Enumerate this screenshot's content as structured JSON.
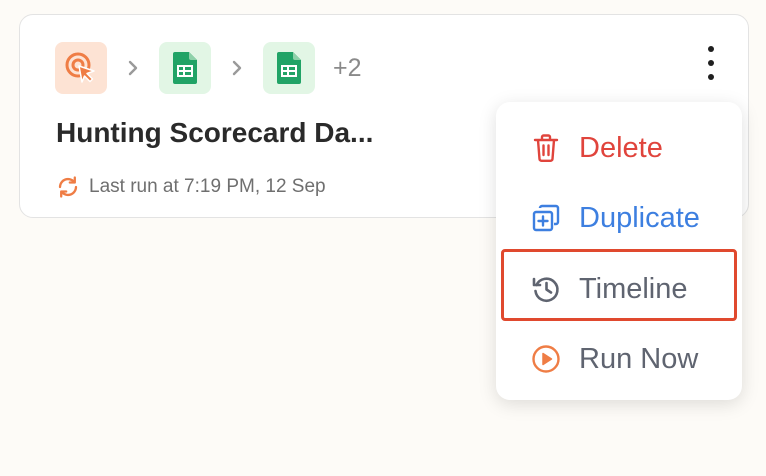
{
  "card": {
    "extra_steps": "+2",
    "title": "Hunting Scorecard Da...",
    "last_run": "Last run at 7:19 PM, 12 Sep",
    "steps": [
      {
        "app": "trigger",
        "icon": "cursor-click-icon"
      },
      {
        "app": "google-sheets",
        "icon": "google-sheets-icon"
      },
      {
        "app": "google-sheets",
        "icon": "google-sheets-icon"
      }
    ]
  },
  "menu": {
    "items": [
      {
        "label": "Delete",
        "icon": "trash-icon",
        "color": "#e0443c"
      },
      {
        "label": "Duplicate",
        "icon": "duplicate-icon",
        "color": "#3d7fe0"
      },
      {
        "label": "Timeline",
        "icon": "history-icon",
        "color": "#5f6470"
      },
      {
        "label": "Run Now",
        "icon": "play-circle-icon",
        "color": "#5f6470"
      }
    ],
    "highlighted": "Timeline"
  },
  "colors": {
    "accent_orange": "#ef7d45",
    "sheets_green": "#21a366",
    "highlight_border": "#e0492e"
  }
}
